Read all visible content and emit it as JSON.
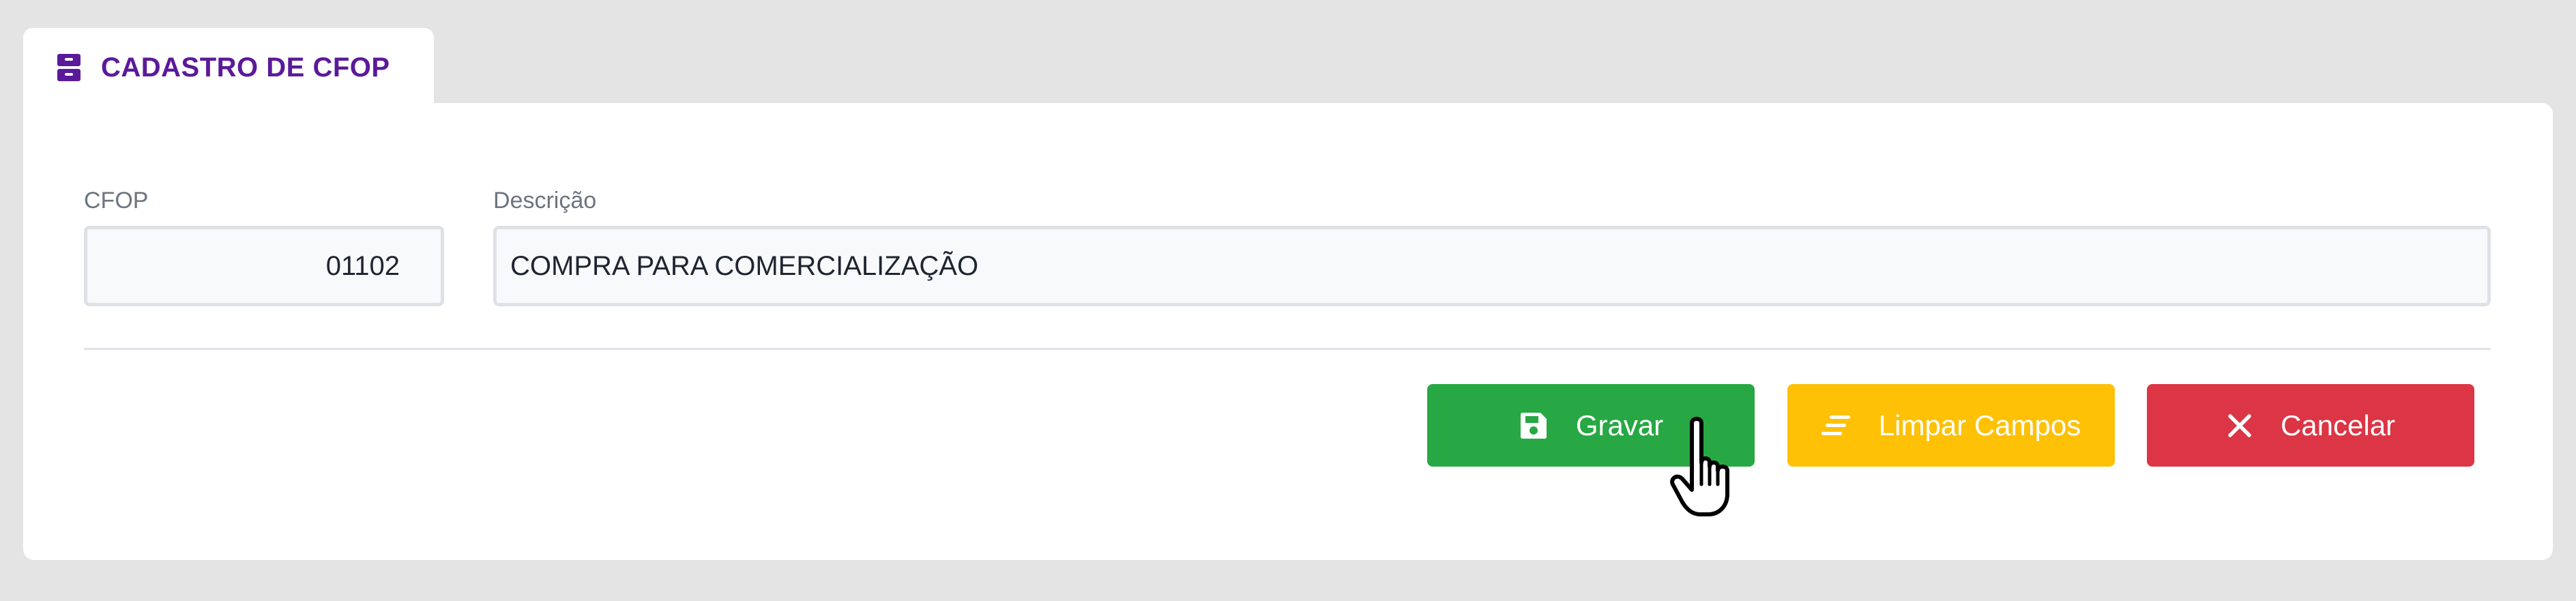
{
  "tab": {
    "title": "CADASTRO DE CFOP",
    "icon": "archive-icon",
    "color": "#5b1a9a"
  },
  "form": {
    "cfop": {
      "label": "CFOP",
      "value": "01102"
    },
    "descricao": {
      "label": "Descrição",
      "value": "COMPRA PARA COMERCIALIZAÇÃO"
    }
  },
  "actions": {
    "save": {
      "label": "Gravar",
      "icon": "floppy-disk-icon",
      "color": "#27a844"
    },
    "clear": {
      "label": "Limpar Campos",
      "icon": "clear-lines-icon",
      "color": "#fec106"
    },
    "cancel": {
      "label": "Cancelar",
      "icon": "close-icon",
      "color": "#dc3545"
    }
  },
  "pointer": {
    "icon": "hand-pointer-icon"
  }
}
